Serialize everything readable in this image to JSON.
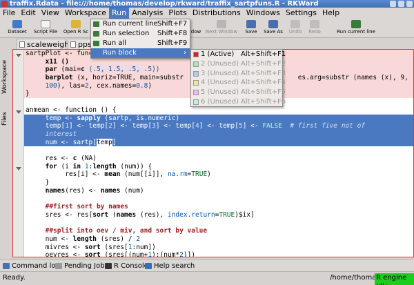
{
  "window": {
    "title": "traffix.Rdata - file:///home/thomas/develop/rkward/traffix_sartpfuns.R - RKWard"
  },
  "menubar": [
    "File",
    "Edit",
    "View",
    "Workspace",
    "Run",
    "Analysis",
    "Plots",
    "Distributions",
    "Windows",
    "Settings",
    "Help"
  ],
  "toolbar": {
    "dataset": "Dataset",
    "script_file": "Script File",
    "open_r": "Open R Sc",
    "window_frag": "dow",
    "next_window": "Next Window",
    "save": "Save",
    "save_as": "Save As",
    "undo": "Undo",
    "redo": "Redo",
    "run_current_line": "Run current line"
  },
  "left_dock": {
    "workspace": "Workspace",
    "files": "Files"
  },
  "tabs": {
    "scaleweights": "scaleweights",
    "ppsc": "ppsc"
  },
  "run_menu": [
    {
      "label": "Run current line",
      "shortcut": "Shift+F7",
      "color": "#3a7a3a"
    },
    {
      "label": "Run selection",
      "shortcut": "Shift+F8",
      "color": "#3a7a3a"
    },
    {
      "label": "Run all",
      "shortcut": "Shift+F9",
      "color": "#3a7a3a"
    },
    {
      "label": "Run block",
      "shortcut": ""
    }
  ],
  "run_block_menu": [
    {
      "label": "1 (Active)",
      "shortcut": "Alt+Shift+F1",
      "color": "#e02020",
      "enabled": true
    },
    {
      "label": "2 (Unused)",
      "shortcut": "Alt+Shift+F2",
      "color": "#a8e8a8",
      "enabled": false
    },
    {
      "label": "3 (Unused)",
      "shortcut": "Alt+Shift+F3",
      "color": "#b8c8f0",
      "enabled": false
    },
    {
      "label": "4 (Unused)",
      "shortcut": "Alt+Shift+F4",
      "color": "#f0e890",
      "enabled": false
    },
    {
      "label": "5 (Unused)",
      "shortcut": "Alt+Shift+F5",
      "color": "#f0b8f0",
      "enabled": false
    },
    {
      "label": "6 (Unused)",
      "shortcut": "Alt+Shift+F6",
      "color": "#b8f0f0",
      "enabled": false
    }
  ],
  "code": {
    "l1_a": "sartpPlot <- func",
    "l2": "x11 ()",
    "l3_fn": "par",
    "l3_a": " (mai=",
    "l3_c": "c",
    "l3_b": " (.5, 1.5, .5, .5))",
    "l4_fn": "barplot",
    "l4_a": " (x, horiz=TRUE, main=substr",
    "l4_b": "es.arg=substr (names (x), 9,",
    "l5_n": "100",
    "l5_a": "), las=",
    "l5_n2": "2",
    "l5_b": ", cex.names=",
    "l5_n3": "0.8",
    "l5_c": ")",
    "l6": "}",
    "l8": "anmean <- function () {",
    "l9_a": "temp <- ",
    "l9_fn": "sapply",
    "l9_b": " (sartp, is.numeric",
    "l9_c": ")",
    "l10_a": "temp[",
    "l10_n1": "1",
    "l10_b": "] <- temp[",
    "l10_n2": "2",
    "l10_c": "] <- temp[",
    "l10_n3": "3",
    "l10_d": "] <- temp[",
    "l10_n4": "4",
    "l10_e": "] <- temp[",
    "l10_n5": "5",
    "l10_f": "] <- ",
    "l10_false": "FALSE",
    "l10_cmt": "  # first five not of",
    "l11_cmt": "interest",
    "l12_a": "num <- sartp[",
    "l12_b": "temp",
    "l12_c": "]",
    "l14_a": "res <- ",
    "l14_fn": "c",
    "l14_b": " (NA)",
    "l15_a": "for",
    "l15_b": " (i ",
    "l15_c": "in",
    "l15_d": " ",
    "l15_n": "1",
    "l15_e": ":",
    "l15_fn": "length",
    "l15_f": " (num)) {",
    "l16_a": "res[i] <- ",
    "l16_fn": "mean",
    "l16_b": " (num[[i]], ",
    "l16_arg": "na.rm",
    "l16_c": "=",
    "l16_t": "TRUE",
    "l16_d": ")",
    "l17": "}",
    "l18_fn": "names",
    "l18_a": "(res) <- ",
    "l18_fn2": "names",
    "l18_b": " (num)",
    "l20": "##first sort by names",
    "l21_a": "sres <- res[",
    "l21_fn": "sort",
    "l21_b": " (",
    "l21_fn2": "names",
    "l21_c": " (res), ",
    "l21_arg": "index.return",
    "l21_d": "=",
    "l21_t": "TRUE",
    "l21_e": ")$ix]",
    "l23": "##split into oev / miv, and sort by value",
    "l24_a": "num <- ",
    "l24_fn": "length",
    "l24_b": " (sres) / ",
    "l24_n": "2",
    "l25_a": "mivres <- ",
    "l25_fn": "sort",
    "l25_b": " (sres[",
    "l25_n": "1",
    "l25_c": ":num])",
    "l26_a": "oevres <- ",
    "l26_fn": "sort",
    "l26_b": " (sres[(num+",
    "l26_n": "1",
    "l26_c": "):(num*",
    "l26_n2": "2",
    "l26_d": ")])"
  },
  "bottom_tabs": [
    "Command log",
    "Pending Jobs",
    "R Console",
    "Help search"
  ],
  "status": {
    "text": "Ready.",
    "cwd": "/home/thomas",
    "engine": "R engine idle"
  }
}
